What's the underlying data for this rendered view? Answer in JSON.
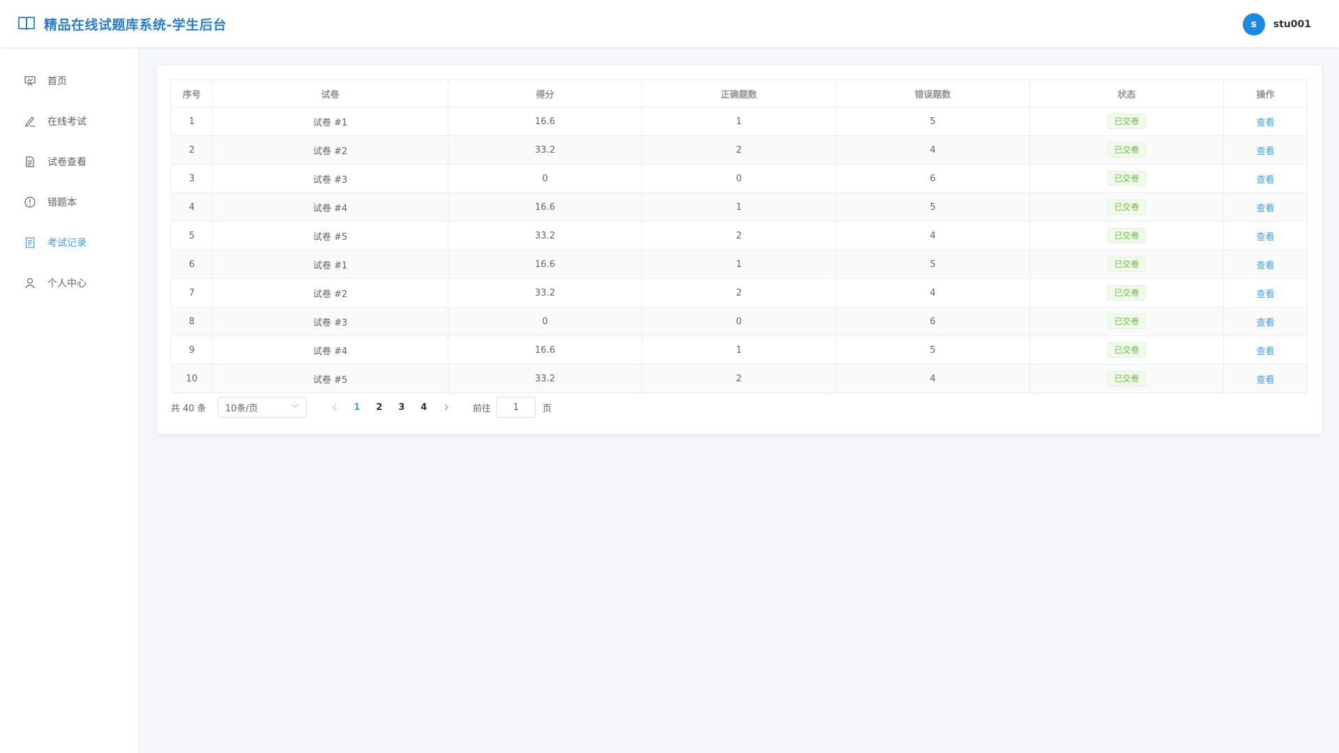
{
  "header": {
    "title": "精品在线试题库系统-学生后台",
    "avatar_letter": "s",
    "username": "stu001",
    "brand_color": "#2a7dd1"
  },
  "sidebar": {
    "items": [
      {
        "label": "首页",
        "icon": "presentation-icon"
      },
      {
        "label": "在线考试",
        "icon": "pencil-icon"
      },
      {
        "label": "试卷查看",
        "icon": "document-icon"
      },
      {
        "label": "错题本",
        "icon": "warning-circle-icon"
      },
      {
        "label": "考试记录",
        "icon": "record-icon",
        "active": true
      },
      {
        "label": "个人中心",
        "icon": "user-icon"
      }
    ],
    "active_color": "#409eff"
  },
  "table": {
    "columns": [
      "序号",
      "试卷",
      "得分",
      "正确题数",
      "错误题数",
      "状态",
      "操作"
    ],
    "rows": [
      {
        "index": "1",
        "paper": "试卷 #1",
        "score": "16.6",
        "correct": "1",
        "wrong": "5",
        "status": "已交卷",
        "action": "查看"
      },
      {
        "index": "2",
        "paper": "试卷 #2",
        "score": "33.2",
        "correct": "2",
        "wrong": "4",
        "status": "已交卷",
        "action": "查看"
      },
      {
        "index": "3",
        "paper": "试卷 #3",
        "score": "0",
        "correct": "0",
        "wrong": "6",
        "status": "已交卷",
        "action": "查看"
      },
      {
        "index": "4",
        "paper": "试卷 #4",
        "score": "16.6",
        "correct": "1",
        "wrong": "5",
        "status": "已交卷",
        "action": "查看"
      },
      {
        "index": "5",
        "paper": "试卷 #5",
        "score": "33.2",
        "correct": "2",
        "wrong": "4",
        "status": "已交卷",
        "action": "查看"
      },
      {
        "index": "6",
        "paper": "试卷 #1",
        "score": "16.6",
        "correct": "1",
        "wrong": "5",
        "status": "已交卷",
        "action": "查看"
      },
      {
        "index": "7",
        "paper": "试卷 #2",
        "score": "33.2",
        "correct": "2",
        "wrong": "4",
        "status": "已交卷",
        "action": "查看"
      },
      {
        "index": "8",
        "paper": "试卷 #3",
        "score": "0",
        "correct": "0",
        "wrong": "6",
        "status": "已交卷",
        "action": "查看"
      },
      {
        "index": "9",
        "paper": "试卷 #4",
        "score": "16.6",
        "correct": "1",
        "wrong": "5",
        "status": "已交卷",
        "action": "查看"
      },
      {
        "index": "10",
        "paper": "试卷 #5",
        "score": "33.2",
        "correct": "2",
        "wrong": "4",
        "status": "已交卷",
        "action": "查看"
      }
    ]
  },
  "pagination": {
    "total_text": "共 40 条",
    "page_size": "10条/页",
    "pages": [
      "1",
      "2",
      "3",
      "4"
    ],
    "current_page": "1",
    "goto_prefix": "前往",
    "goto_value": "1",
    "goto_suffix": "页"
  }
}
